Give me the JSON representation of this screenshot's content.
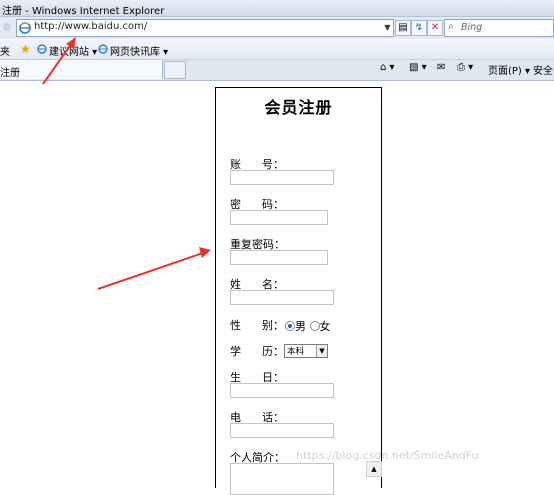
{
  "window": {
    "title": "注册 - Windows Internet Explorer"
  },
  "address_bar": {
    "url": "http://www.baidu.com/",
    "search_placeholder": "Bing"
  },
  "favorites_bar": {
    "folder_label": "夹",
    "items": [
      {
        "label": "建议网站 ▾"
      },
      {
        "label": "网页快讯库 ▾"
      }
    ]
  },
  "tabs": {
    "active_label": "注册"
  },
  "command_bar": {
    "page_label": "页面(P) ▾",
    "safety_label": "安全(S"
  },
  "page": {
    "title": "会员注册",
    "fields": [
      {
        "label": "账      号：",
        "value": ""
      },
      {
        "label": "密      码：",
        "value": ""
      },
      {
        "label": "重复密码：",
        "value": ""
      },
      {
        "label": "姓      名：",
        "value": ""
      }
    ],
    "gender": {
      "label": "性      别：",
      "options": [
        {
          "label": "男",
          "checked": true
        },
        {
          "label": "女",
          "checked": false
        }
      ]
    },
    "education": {
      "label": "学      历：",
      "selected": "本科"
    },
    "birthday": {
      "label": "生      日：",
      "value": ""
    },
    "phone": {
      "label": "电      话：",
      "value": ""
    },
    "intro": {
      "label": "个人简介："
    }
  },
  "watermark": "https://blog.csdn.net/SmileAndFu",
  "annotation_color": "#e8332c"
}
